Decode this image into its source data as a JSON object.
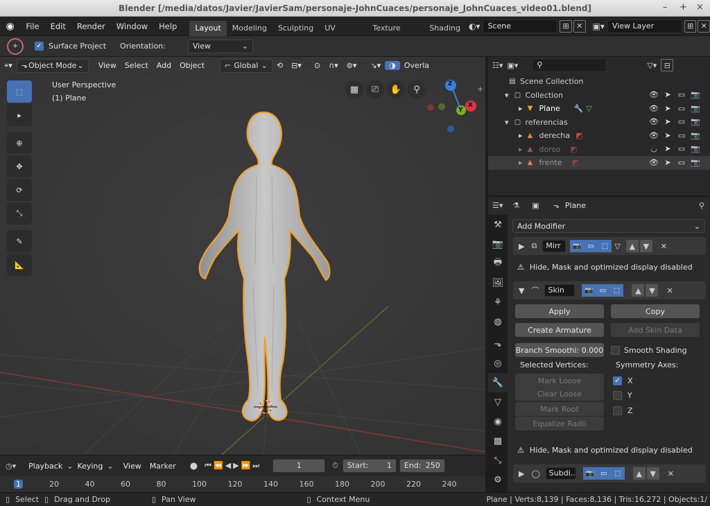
{
  "window": {
    "title": "Blender [/media/datos/Javier/JavierSam/personaje-JohnCuaces/personaje_JohnCuaces_video01.blend]",
    "min": "–",
    "max": "+",
    "close": "×"
  },
  "menus": [
    "File",
    "Edit",
    "Render",
    "Window",
    "Help"
  ],
  "workspaces": [
    "Layout",
    "Modeling",
    "Sculpting",
    "UV Editing",
    "Texture Paint",
    "Shading"
  ],
  "scene": {
    "name": "Scene",
    "view_layer": "View Layer"
  },
  "tool_settings": {
    "surface_project": "Surface Project",
    "orientation_label": "Orientation:",
    "orientation_value": "View"
  },
  "viewport": {
    "mode": "Object Mode",
    "menus": [
      "View",
      "Select",
      "Add",
      "Object"
    ],
    "transform": "Global",
    "overlays": "Overla",
    "perspective": "User Perspective",
    "active": "(1) Plane",
    "gizmo": {
      "z": "Z",
      "y": "Y",
      "x": "X"
    }
  },
  "timeline": {
    "menus": [
      "Playback",
      "Keying",
      "View",
      "Marker"
    ],
    "current_frame": "1",
    "start_label": "Start:",
    "start": "1",
    "end_label": "End:",
    "end": "250",
    "ruler": [
      "1",
      "20",
      "40",
      "60",
      "80",
      "100",
      "120",
      "140",
      "160",
      "180",
      "200",
      "220",
      "240"
    ]
  },
  "statusbar": {
    "select": "Select",
    "drag": "Drag and Drop",
    "pan": "Pan View",
    "context": "Context Menu",
    "stats": "Plane | Verts:8,139 | Faces:8,136 | Tris:16,272 | Objects:1/"
  },
  "outliner": {
    "search": "",
    "rows": [
      {
        "label": "Scene Collection",
        "kind": "scene"
      },
      {
        "label": "Collection",
        "kind": "collection"
      },
      {
        "label": "Plane",
        "kind": "object"
      },
      {
        "label": "referencias",
        "kind": "collection"
      },
      {
        "label": "derecha",
        "kind": "image"
      },
      {
        "label": "dorso",
        "kind": "image"
      },
      {
        "label": "frente",
        "kind": "image"
      }
    ]
  },
  "properties": {
    "object": "Plane",
    "add_modifier": "Add Modifier",
    "mirror_name": "Mirr",
    "warning": "Hide, Mask and optimized display disabled",
    "skin_name": "Skin",
    "apply": "Apply",
    "copy": "Copy",
    "create_armature": "Create Armature",
    "add_skin_data": "Add Skin Data",
    "branch_smoothing": "Branch Smoothi: 0.000",
    "smooth_shading": "Smooth Shading",
    "selected_vertices": "Selected Vertices:",
    "symmetry_axes": "Symmetry Axes:",
    "mark_loose": "Mark Loose",
    "clear_loose": "Clear Loose",
    "mark_root": "Mark Root",
    "equalize_radii": "Equalize Radii",
    "axes": [
      "X",
      "Y",
      "Z"
    ],
    "warning2": "Hide, Mask and optimized display disabled",
    "subdiv_name": "Subdi.."
  }
}
